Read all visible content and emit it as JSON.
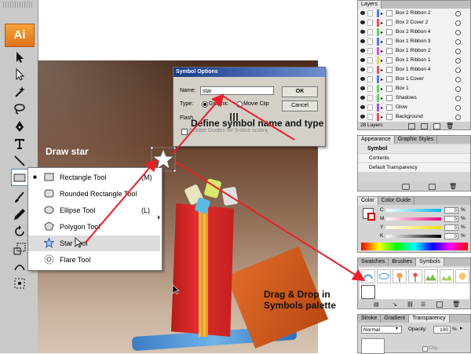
{
  "app": {
    "logo": "Ai"
  },
  "toolbar": {
    "tools": [
      "selection-tool",
      "direct-selection-tool",
      "magic-wand-tool",
      "lasso-tool",
      "pen-tool",
      "type-tool",
      "line-tool",
      "rectangle-tool",
      "paintbrush-tool",
      "pencil-tool",
      "rotate-tool",
      "scale-tool",
      "symbol-sprayer-tool"
    ]
  },
  "annotations": {
    "draw_star": "Draw star",
    "define_symbol": "Define symbol name and type",
    "drag_drop": "Drag & Drop in Symbols palette"
  },
  "dialog": {
    "title": "Symbol Options",
    "name_label": "Name:",
    "name_value": "star",
    "type_label": "Type:",
    "type_graphic": "Graphic",
    "type_movieclip": "Movie Clip",
    "flash_label": "Flash",
    "enable_guides": "Enable Guides for 9-slice scaling",
    "ok_label": "OK",
    "cancel_label": "Cancel"
  },
  "flyout": {
    "items": [
      {
        "label": "Rectangle Tool",
        "key": "(M)",
        "icon": "rectangle-icon",
        "current": true
      },
      {
        "label": "Rounded Rectangle Tool",
        "key": "",
        "icon": "rounded-rectangle-icon"
      },
      {
        "label": "Ellipse Tool",
        "key": "(L)",
        "icon": "ellipse-icon"
      },
      {
        "label": "Polygon Tool",
        "key": "",
        "icon": "polygon-icon"
      },
      {
        "label": "Star Tool",
        "key": "",
        "icon": "star-icon",
        "hovered": true
      },
      {
        "label": "Flare Tool",
        "key": "",
        "icon": "flare-icon"
      }
    ]
  },
  "layers_panel": {
    "tab": "Layers",
    "rows": [
      {
        "name": "Box 2 Ribbon 2",
        "color": "#4f7be8"
      },
      {
        "name": "Box 2 Cover 2",
        "color": "#e84f4f"
      },
      {
        "name": "Box 2 Ribbon 4",
        "color": "#5fd65f"
      },
      {
        "name": "Box 1 Ribbon 3",
        "color": "#4f7be8"
      },
      {
        "name": "Box 1 Ribbon 2",
        "color": "#e84fd6"
      },
      {
        "name": "Box 1 Ribbon 1",
        "color": "#e8d64f"
      },
      {
        "name": "Box 1 Ribbon 4",
        "color": "#e84f4f"
      },
      {
        "name": "Box 1 Cover",
        "color": "#4f7be8"
      },
      {
        "name": "Box 1",
        "color": "#5fd65f"
      },
      {
        "name": "Shadows",
        "color": "#5fd65f"
      },
      {
        "name": "Glow",
        "color": "#9a4fe8"
      },
      {
        "name": "Background",
        "color": "#e84f4f"
      }
    ],
    "count": "28 Layers"
  },
  "appearance_panel": {
    "tabs": [
      "Appearance",
      "Graphic Styles"
    ],
    "object": "Symbol",
    "rows": [
      "Contents",
      "Default Transparency"
    ]
  },
  "color_panel": {
    "tabs": [
      "Color",
      "Color Guide"
    ],
    "channels": [
      {
        "label": "C",
        "value": "0",
        "unit": "%",
        "color": "#00b7e8"
      },
      {
        "label": "M",
        "value": "0",
        "unit": "%",
        "color": "#e8007a"
      },
      {
        "label": "Y",
        "value": "0",
        "unit": "%",
        "color": "#f0e000"
      },
      {
        "label": "K",
        "value": "0",
        "unit": "%",
        "color": "#000000"
      }
    ]
  },
  "swatches_panel": {
    "tabs": [
      "Swatches",
      "Brushes",
      "Symbols"
    ]
  },
  "transparency_panel": {
    "tabs": [
      "Stroke",
      "Gradient",
      "Transparency"
    ],
    "blend_mode": "Normal",
    "opacity_label": "Opacity:",
    "opacity_value": "100",
    "opacity_unit": "%",
    "clip_label": "Clip"
  }
}
